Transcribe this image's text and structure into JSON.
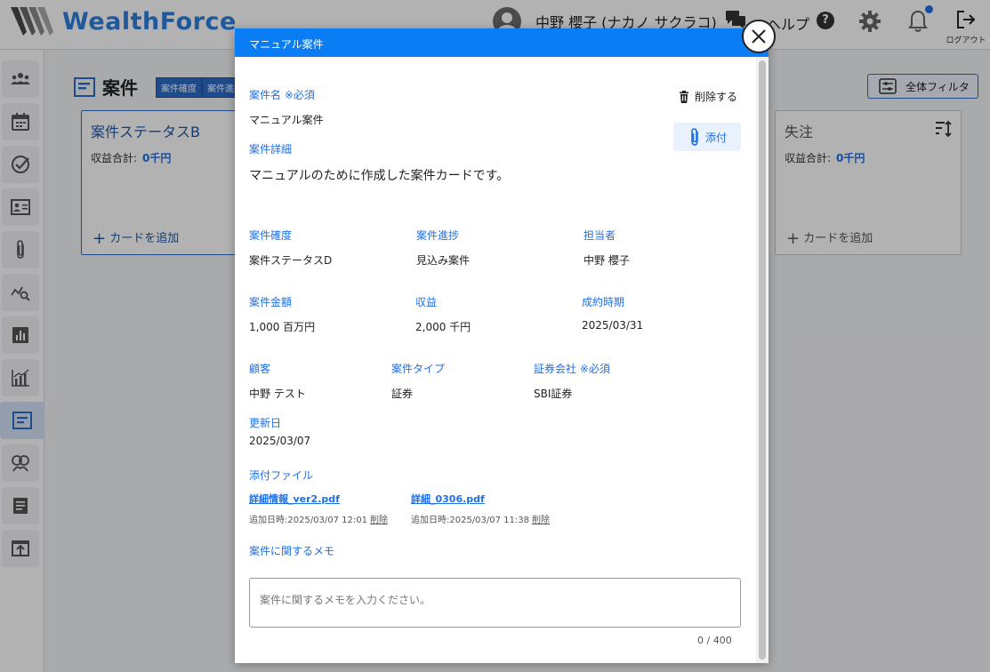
{
  "header": {
    "logo_text": "WealthForce",
    "user_name": "中野 櫻子 (ナカノ サクラコ)",
    "help_label": "ヘルプ",
    "help_icon_glyph": "?",
    "logout_label": "ログアウト"
  },
  "page": {
    "title": "案件",
    "chips": [
      "案件確度",
      "案件進捗"
    ],
    "filter_label": "全体フィルタ"
  },
  "lanes": [
    {
      "title": "案件ステータスB",
      "sum_label": "収益合計:",
      "sum_value": "0千円",
      "add_label": "カードを追加"
    },
    {
      "title": "失注",
      "sum_label": "収益合計:",
      "sum_value": "0千円",
      "add_label": "カードを追加"
    }
  ],
  "modal": {
    "title": "マニュアル案件",
    "delete_label": "削除する",
    "attach_label": "添付",
    "fields": {
      "case_name_label": "案件名 ※必須",
      "case_name_value": "マニュアル案件",
      "detail_label": "案件詳細",
      "detail_value": "マニュアルのために作成した案件カードです。",
      "certainty_label": "案件確度",
      "certainty_value": "案件ステータスD",
      "progress_label": "案件進捗",
      "progress_value": "見込み案件",
      "owner_label": "担当者",
      "owner_value": "中野 櫻子",
      "amount_label": "案件金額",
      "amount_value": "1,000 百万円",
      "revenue_label": "収益",
      "revenue_value": "2,000 千円",
      "close_label": "成約時期",
      "close_value": "2025/03/31",
      "customer_label": "顧客",
      "customer_value": "中野 テスト",
      "type_label": "案件タイプ",
      "type_value": "証券",
      "broker_label": "証券会社 ※必須",
      "broker_value": "SBI証券",
      "updated_label": "更新日",
      "updated_value": "2025/03/07"
    },
    "attachments_label": "添付ファイル",
    "attachments": [
      {
        "name": "詳細情報_ver2.pdf",
        "meta": "追加日時:2025/03/07 12:01",
        "delete": "削除"
      },
      {
        "name": "詳細_0306.pdf",
        "meta": "追加日時:2025/03/07 11:38",
        "delete": "削除"
      }
    ],
    "memo_label": "案件に関するメモ",
    "memo_placeholder": "案件に関するメモを入力ください。",
    "memo_counter": "0 / 400"
  },
  "colors": {
    "brand_blue": "#2f7fe0",
    "modal_header": "#0a7df5",
    "label_blue": "#1f6fe5"
  }
}
